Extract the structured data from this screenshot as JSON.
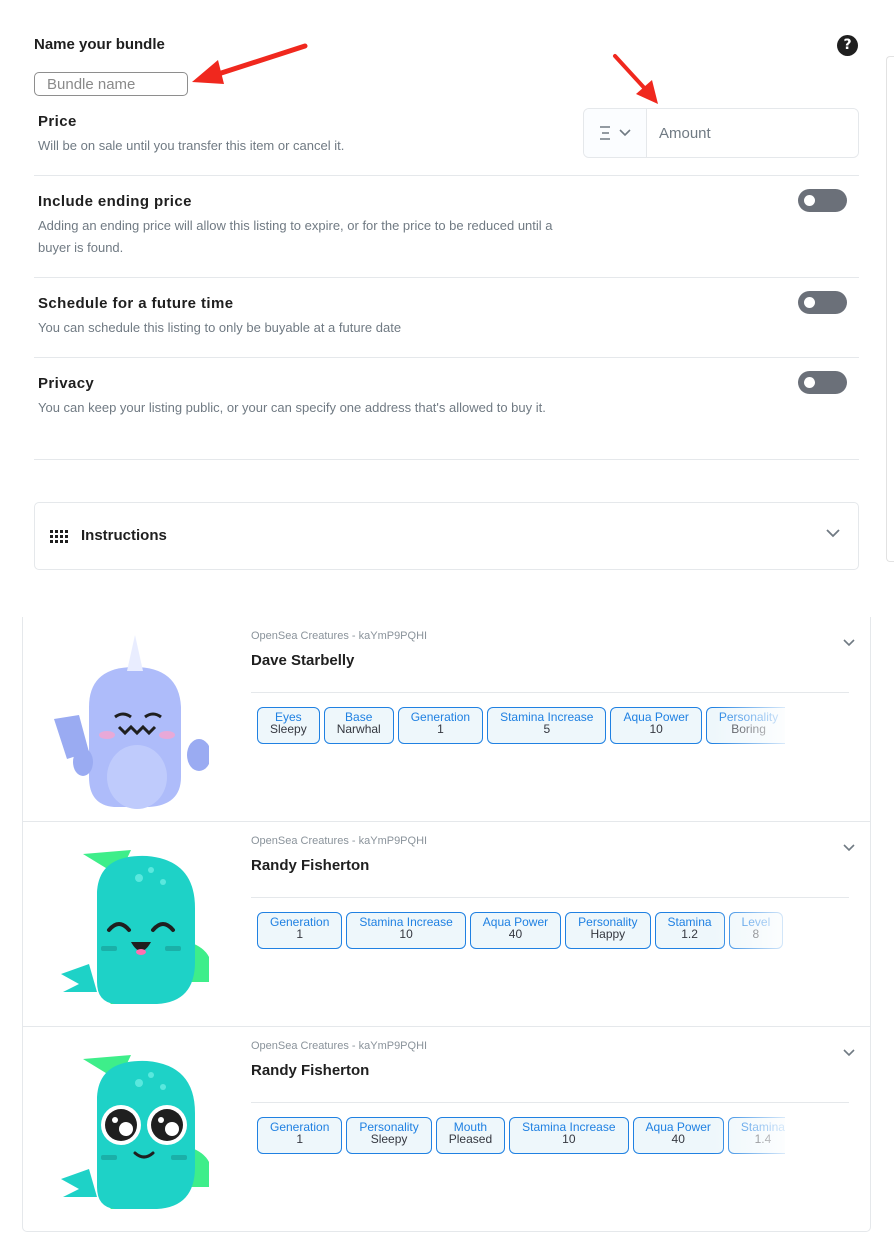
{
  "header": {
    "bundle_label": "Name your bundle",
    "bundle_placeholder": "Bundle name",
    "help_icon": "question-circle-icon"
  },
  "price": {
    "title": "Price",
    "description": "Will be on sale until you transfer this item or cancel it.",
    "currency_icon": "ethereum-icon",
    "amount_placeholder": "Amount"
  },
  "ending_price": {
    "title": "Include ending price",
    "description": "Adding an ending price will allow this listing to expire, or for the price to be reduced until a buyer is found.",
    "enabled": false
  },
  "schedule": {
    "title": "Schedule for a future time",
    "description": "You can schedule this listing to only be buyable at a future date",
    "enabled": false
  },
  "privacy": {
    "title": "Privacy",
    "description": "You can keep your listing public, or your can specify one address that's allowed to buy it.",
    "enabled": false
  },
  "instructions": {
    "label": "Instructions",
    "icon": "grid-icon"
  },
  "colors": {
    "accent": "#2081e2",
    "toggle_off": "#6b7079",
    "arrow": "#f0281e",
    "narwhal_body": "#aebcfa",
    "fish_body": "#1ed2c7",
    "fish_fin": "#3eee8a"
  },
  "items": [
    {
      "collection": "OpenSea Creatures - kaYmP9PQHI",
      "name": "Dave Starbelly",
      "traits": [
        {
          "type": "Eyes",
          "value": "Sleepy"
        },
        {
          "type": "Base",
          "value": "Narwhal"
        },
        {
          "type": "Generation",
          "value": "1"
        },
        {
          "type": "Stamina Increase",
          "value": "5"
        },
        {
          "type": "Aqua Power",
          "value": "10"
        },
        {
          "type": "Personality",
          "value": "Boring"
        }
      ]
    },
    {
      "collection": "OpenSea Creatures - kaYmP9PQHI",
      "name": "Randy Fisherton",
      "traits": [
        {
          "type": "Generation",
          "value": "1"
        },
        {
          "type": "Stamina Increase",
          "value": "10"
        },
        {
          "type": "Aqua Power",
          "value": "40"
        },
        {
          "type": "Personality",
          "value": "Happy"
        },
        {
          "type": "Stamina",
          "value": "1.2"
        },
        {
          "type": "Level",
          "value": "8"
        }
      ]
    },
    {
      "collection": "OpenSea Creatures - kaYmP9PQHI",
      "name": "Randy Fisherton",
      "traits": [
        {
          "type": "Generation",
          "value": "1"
        },
        {
          "type": "Personality",
          "value": "Sleepy"
        },
        {
          "type": "Mouth",
          "value": "Pleased"
        },
        {
          "type": "Stamina Increase",
          "value": "10"
        },
        {
          "type": "Aqua Power",
          "value": "40"
        },
        {
          "type": "Stamina",
          "value": "1.4"
        }
      ]
    }
  ]
}
